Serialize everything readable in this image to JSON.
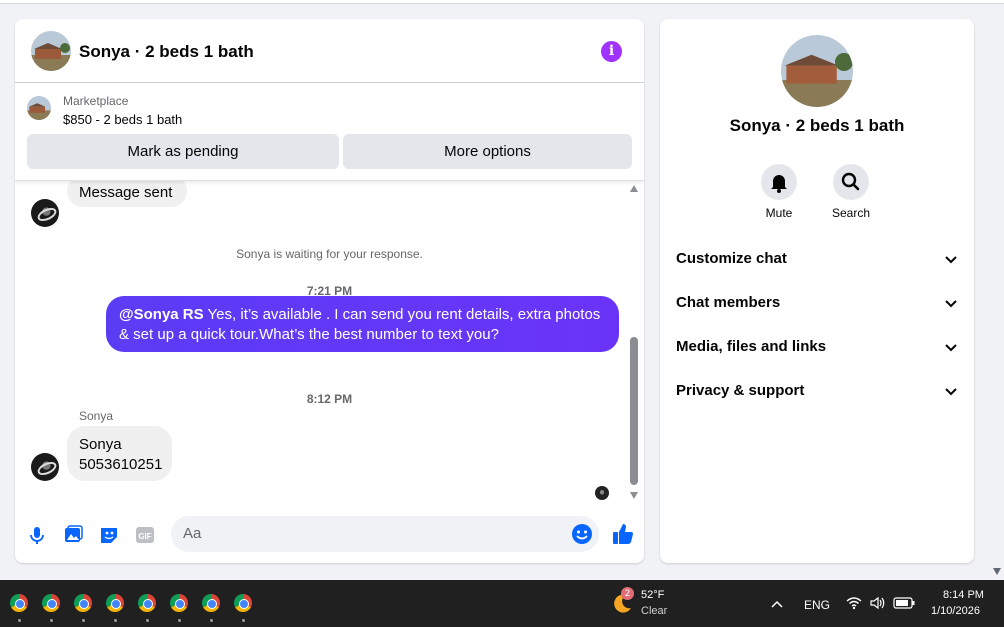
{
  "chat": {
    "title": "Sonya · 2 beds 1 bath",
    "marketplace": {
      "label": "Marketplace",
      "price_line": "$850 - 2 beds 1 bath",
      "mark_pending_label": "Mark as pending",
      "more_options_label": "More options"
    },
    "messages": {
      "top_partial": "Message sent",
      "waiting_text": "Sonya is waiting for your response.",
      "time1": "7:21 PM",
      "outgoing_mention": "@Sonya RS",
      "outgoing_text": " Yes, it’s available .  I can send you rent details, extra photos & set up a quick tour.What’s the best number to text you?",
      "time2": "8:12 PM",
      "sender_name": "Sonya",
      "incoming_line1": "Sonya",
      "incoming_line2": "5053610251"
    },
    "composer": {
      "placeholder": "Aa",
      "gif_label": "GIF"
    },
    "accent_color": "#5b3cf5"
  },
  "info_panel": {
    "title": "Sonya · 2 beds 1 bath",
    "mute_label": "Mute",
    "search_label": "Search",
    "sections": [
      "Customize chat",
      "Chat members",
      "Media, files and links",
      "Privacy & support"
    ]
  },
  "taskbar": {
    "app_icons": [
      "chrome-icon",
      "chrome-icon",
      "chrome-icon",
      "chrome-icon",
      "chrome-icon",
      "chrome-icon",
      "chrome-icon",
      "chrome-icon"
    ],
    "weather_badge": "2",
    "temperature": "52°F",
    "condition": "Clear",
    "language": "ENG",
    "time": "8:14 PM",
    "date": "1/10/2026"
  }
}
